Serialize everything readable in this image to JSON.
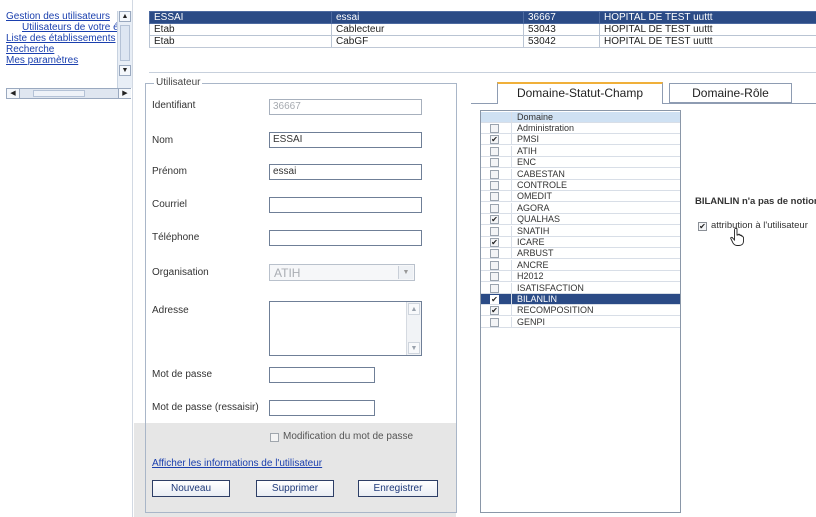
{
  "nav": {
    "links": [
      "Gestion des utilisateurs",
      "Utilisateurs de votre étab",
      "Liste des établissements",
      "Recherche",
      "Mes paramètres"
    ]
  },
  "top_table": {
    "rows": [
      {
        "c1": "ESSAI",
        "c2": "essai",
        "c3": "36667",
        "c4": "HOPITAL DE TEST uuttt",
        "selected": true
      },
      {
        "c1": "Etab",
        "c2": "Cablecteur",
        "c3": "53043",
        "c4": "HOPITAL DE TEST uuttt",
        "selected": false
      },
      {
        "c1": "Etab",
        "c2": "CabGF",
        "c3": "53042",
        "c4": "HOPITAL DE TEST uuttt",
        "selected": false
      }
    ]
  },
  "user": {
    "legend": "Utilisateur",
    "identifiant_label": "Identifiant",
    "identifiant_value": "36667",
    "nom_label": "Nom",
    "nom_value": "ESSAI",
    "prenom_label": "Prénom",
    "prenom_value": "essai",
    "courriel_label": "Courriel",
    "courriel_value": "",
    "telephone_label": "Téléphone",
    "telephone_value": "",
    "organisation_label": "Organisation",
    "organisation_value": "ATIH",
    "adresse_label": "Adresse",
    "password_label": "Mot de passe",
    "password_confirm_label": "Mot de passe (ressaisir)",
    "modif_password_label": "Modification du mot de passe",
    "show_info_link": "Afficher les informations de l'utilisateur",
    "btn_new": "Nouveau",
    "btn_delete": "Supprimer",
    "btn_save": "Enregistrer"
  },
  "tabs": {
    "tab1": "Domaine-Statut-Champ",
    "tab2": "Domaine-Rôle"
  },
  "domains": {
    "header": "Domaine",
    "items": [
      {
        "name": "Administration",
        "checked": false
      },
      {
        "name": "PMSI",
        "checked": true
      },
      {
        "name": "ATIH",
        "checked": false
      },
      {
        "name": "ENC",
        "checked": false
      },
      {
        "name": "CABESTAN",
        "checked": false
      },
      {
        "name": "CONTROLE",
        "checked": false
      },
      {
        "name": "OMEDIT",
        "checked": false
      },
      {
        "name": "AGORA",
        "checked": false
      },
      {
        "name": "QUALHAS",
        "checked": true
      },
      {
        "name": "SNATIH",
        "checked": false
      },
      {
        "name": "ICARE",
        "checked": true
      },
      {
        "name": "ARBUST",
        "checked": false
      },
      {
        "name": "ANCRE",
        "checked": false
      },
      {
        "name": "H2012",
        "checked": false
      },
      {
        "name": "ISATISFACTION",
        "checked": false
      },
      {
        "name": "BILANLIN",
        "checked": true,
        "selected": true
      },
      {
        "name": "RECOMPOSITION",
        "checked": true
      },
      {
        "name": "GENPI",
        "checked": false
      }
    ]
  },
  "bilanlin": {
    "notice": "BILANLIN n'a pas de notion de",
    "attribution_label": "attribution à l'utilisateur",
    "attribution_checked": true
  }
}
